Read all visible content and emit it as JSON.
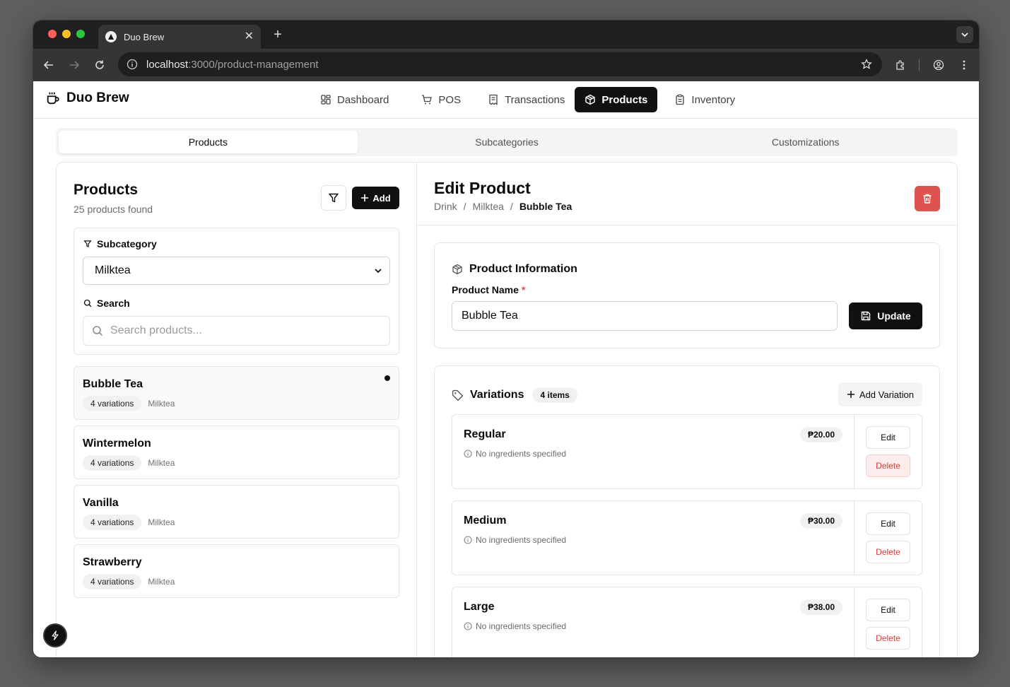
{
  "browser": {
    "tab_title": "Duo Brew",
    "url_host": "localhost",
    "url_rest": ":3000/product-management"
  },
  "app": {
    "brand": "Duo Brew",
    "nav": [
      {
        "label": "Dashboard",
        "icon": "dashboard-icon"
      },
      {
        "label": "POS",
        "icon": "cart-icon"
      },
      {
        "label": "Transactions",
        "icon": "receipt-icon"
      },
      {
        "label": "Products",
        "icon": "package-icon",
        "active": true
      },
      {
        "label": "Inventory",
        "icon": "clipboard-icon"
      }
    ],
    "subtabs": [
      {
        "label": "Products",
        "active": true
      },
      {
        "label": "Subcategories"
      },
      {
        "label": "Customizations"
      }
    ]
  },
  "products_panel": {
    "title": "Products",
    "count": "25 products found",
    "add_label": "Add",
    "subcategory_label": "Subcategory",
    "subcategory_value": "Milktea",
    "search_label": "Search",
    "search_placeholder": "Search products...",
    "items": [
      {
        "name": "Bubble Tea",
        "variations": "4 variations",
        "category": "Milktea",
        "selected": true
      },
      {
        "name": "Wintermelon",
        "variations": "4 variations",
        "category": "Milktea"
      },
      {
        "name": "Vanilla",
        "variations": "4 variations",
        "category": "Milktea"
      },
      {
        "name": "Strawberry",
        "variations": "4 variations",
        "category": "Milktea"
      }
    ]
  },
  "edit_panel": {
    "title": "Edit Product",
    "breadcrumb": [
      "Drink",
      "/",
      "Milktea",
      "/",
      "Bubble Tea"
    ],
    "info": {
      "title": "Product Information",
      "name_label": "Product Name",
      "required_mark": "*",
      "name_value": "Bubble Tea",
      "update_label": "Update"
    },
    "variations": {
      "title": "Variations",
      "count": "4 items",
      "add_label": "Add Variation",
      "items": [
        {
          "name": "Regular",
          "price": "₱20.00",
          "note": "No ingredients specified",
          "edit": "Edit",
          "delete": "Delete"
        },
        {
          "name": "Medium",
          "price": "₱30.00",
          "note": "No ingredients specified",
          "edit": "Edit",
          "delete": "Delete"
        },
        {
          "name": "Large",
          "price": "₱38.00",
          "note": "No ingredients specified",
          "edit": "Edit",
          "delete": "Delete"
        }
      ]
    }
  },
  "colors": {
    "accent": "#111111",
    "danger": "#e0524d",
    "traffic_red": "#ff5f57",
    "traffic_yellow": "#febc2e",
    "traffic_green": "#28c840"
  }
}
